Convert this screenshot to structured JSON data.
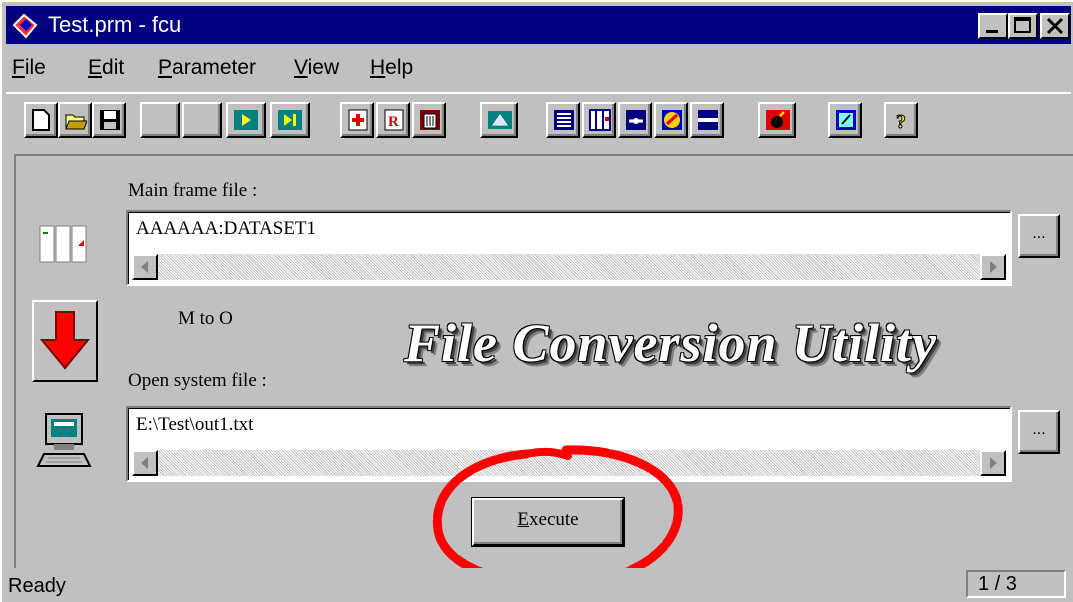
{
  "window": {
    "title": "Test.prm - fcu",
    "controls": {
      "minimize": "minimize",
      "maximize": "maximize",
      "close": "close"
    }
  },
  "menu": {
    "items": [
      {
        "label": "File",
        "underline": "F"
      },
      {
        "label": "Edit",
        "underline": "E"
      },
      {
        "label": "Parameter",
        "underline": "P"
      },
      {
        "label": "View",
        "underline": "V"
      },
      {
        "label": "Help",
        "underline": "H"
      }
    ]
  },
  "toolbar": {
    "buttons": [
      "new-file-icon",
      "open-folder-icon",
      "save-icon",
      "blank-icon",
      "blank-icon",
      "play-icon",
      "step-icon",
      "add-icon",
      "record-icon",
      "trash-icon",
      "network-icon",
      "database-icon",
      "layout-icon",
      "connection-icon",
      "globe-icon",
      "line-icon",
      "bomb-icon",
      "edit-icon",
      "help-icon"
    ]
  },
  "main": {
    "mainframe_label": "Main frame file :",
    "mainframe_value": "AAAAAA:DATASET1",
    "direction_label": "M to O",
    "open_label": "Open system file :",
    "open_value": "E:\\Test\\out1.txt",
    "browse_label": "...",
    "banner": "File Conversion Utility",
    "execute_label": "Execute",
    "execute_underline": "E"
  },
  "status": {
    "text": "Ready",
    "page": "1 / 3"
  },
  "colors": {
    "titlebar": "#000080",
    "face": "#c0c0c0",
    "annotation": "#ff0000"
  }
}
